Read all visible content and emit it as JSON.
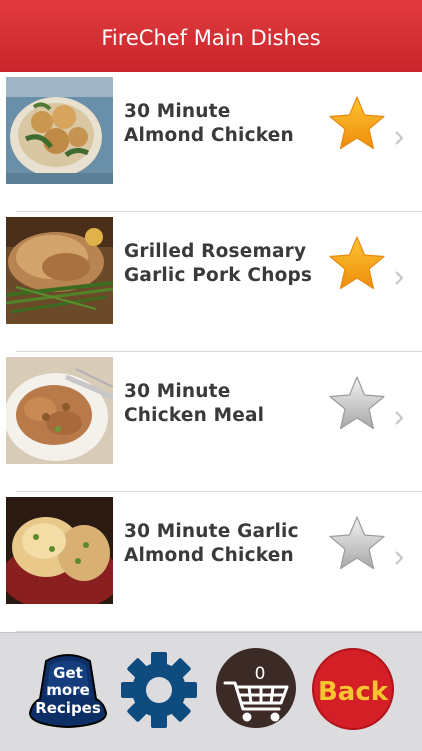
{
  "header": {
    "title": "FireChef Main Dishes"
  },
  "recipes": [
    {
      "title": "30 Minute Almond Chicken",
      "favorite": true,
      "star_icon": "star-filled-icon"
    },
    {
      "title": "Grilled Rosemary Garlic Pork Chops",
      "favorite": true,
      "star_icon": "star-filled-icon"
    },
    {
      "title": "30 Minute Chicken Meal",
      "favorite": false,
      "star_icon": "star-outline-icon"
    },
    {
      "title": "30 Minute Garlic Almond Chicken",
      "favorite": false,
      "star_icon": "star-outline-icon"
    }
  ],
  "toolbar": {
    "get_more": {
      "line1": "Get",
      "line2": "more",
      "line3": "Recipes"
    },
    "settings_icon": "gear-icon",
    "cart": {
      "count": "0",
      "icon": "shopping-cart-icon"
    },
    "back_label": "Back"
  },
  "colors": {
    "header": "#d32f34",
    "star_gold": "#f6a316",
    "star_gray": "#b9b9b9",
    "gear_blue": "#0e4c80",
    "back_red": "#d51f26",
    "back_text": "#f7c531",
    "cart_bg": "#3b2a26"
  }
}
